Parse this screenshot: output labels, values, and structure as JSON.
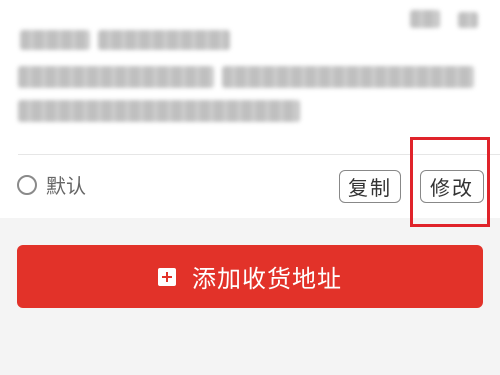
{
  "address_card": {
    "default_label": "默认",
    "copy_label": "复制",
    "edit_label": "修改"
  },
  "add_address_label": "添加收货地址",
  "colors": {
    "accent": "#e23229",
    "highlight": "#e0232a"
  }
}
